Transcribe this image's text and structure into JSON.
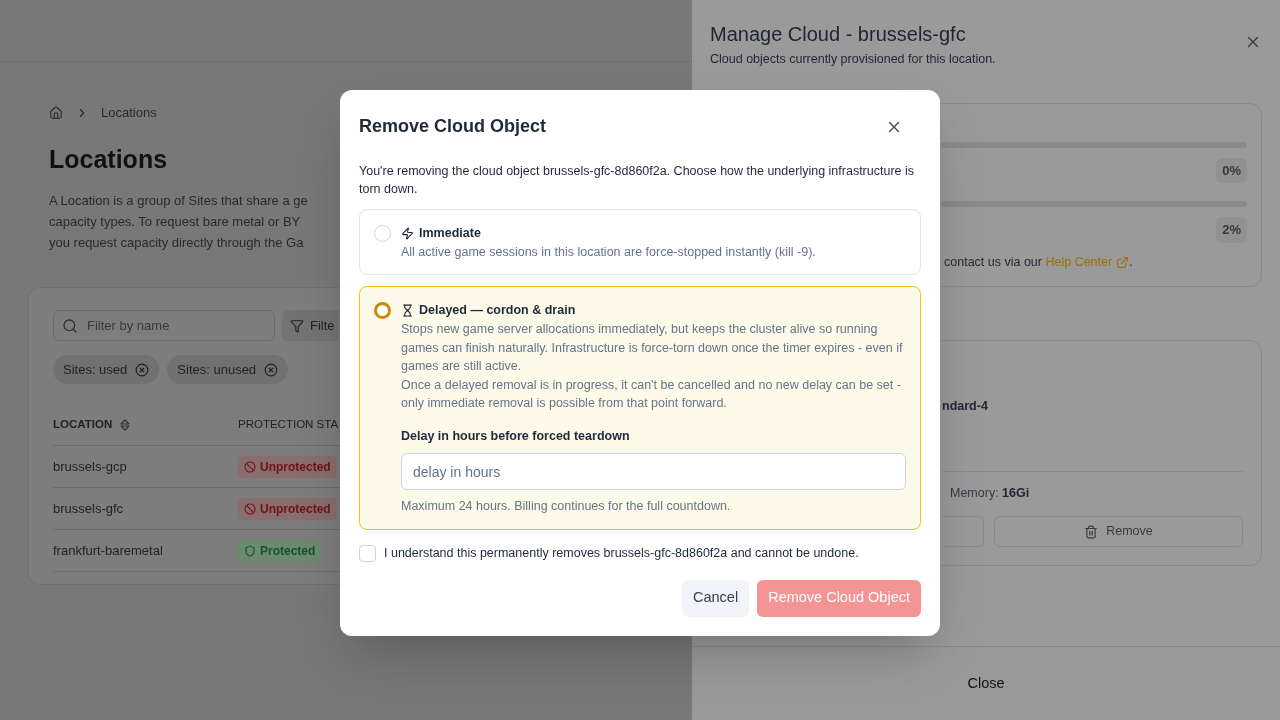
{
  "page": {
    "breadcrumb": [
      "Locations"
    ],
    "title": "Locations",
    "description_lines": [
      "A Location is a group of Sites that share a ge",
      "capacity types. To request bare metal or BY",
      "you request capacity directly through the Ga"
    ],
    "search": {
      "placeholder": "Filter by name"
    },
    "filter_button": "Filte",
    "chips": [
      "Sites: used",
      "Sites: unused"
    ],
    "table": {
      "columns": [
        {
          "label": "LOCATION",
          "sortable": true
        },
        {
          "label": "PROTECTION STA",
          "sortable": false
        }
      ],
      "rows": [
        {
          "location": "brussels-gcp",
          "protection": {
            "kind": "unprotected",
            "label": "Unprotected"
          }
        },
        {
          "location": "brussels-gfc",
          "protection": {
            "kind": "unprotected",
            "label": "Unprotected"
          }
        },
        {
          "location": "frankfurt-baremetal",
          "protection": {
            "kind": "protected",
            "label": "Protected"
          }
        }
      ]
    }
  },
  "drawer": {
    "title": "Manage Cloud - brussels-gfc",
    "subtitle": "Cloud objects currently provisioned for this location.",
    "usage": [
      {
        "reading": "0%"
      },
      {
        "reading": "2%"
      }
    ],
    "help": {
      "text": "contact us via our",
      "link": "Help Center",
      "end": "."
    },
    "object": {
      "machine": "ndard-4",
      "memory_label": "Memory:",
      "memory_value": "16Gi",
      "remove_button": "Remove"
    },
    "close_button": "Close"
  },
  "dialog": {
    "title": "Remove Cloud Object",
    "description": "You're removing the cloud object brussels-gfc-8d860f2a. Choose how the underlying infrastructure is torn down.",
    "options": [
      {
        "kind": "immediate",
        "label": "Immediate",
        "selected": false,
        "paragraphs": [
          "All active game sessions in this location are force-stopped instantly (kill -9)."
        ]
      },
      {
        "kind": "delayed",
        "label": "Delayed — cordon & drain",
        "selected": true,
        "paragraphs": [
          "Stops new game server allocations immediately, but keeps the cluster alive so running games can finish naturally. Infrastructure is force-torn down once the timer expires - even if games are still active.",
          "Once a delayed removal is in progress, it can't be cancelled and no new delay can be set - only immediate removal is possible from that point forward."
        ],
        "field": {
          "label": "Delay in hours before forced teardown",
          "placeholder": "delay in hours",
          "hint": "Maximum 24 hours. Billing continues for the full countdown."
        }
      }
    ],
    "confirm": {
      "label": "I understand this permanently removes brussels-gfc-8d860f2a and cannot be undone.",
      "checked": false
    },
    "cancel_button": "Cancel",
    "remove_button": {
      "label": "Remove Cloud Object",
      "disabled": true
    }
  }
}
